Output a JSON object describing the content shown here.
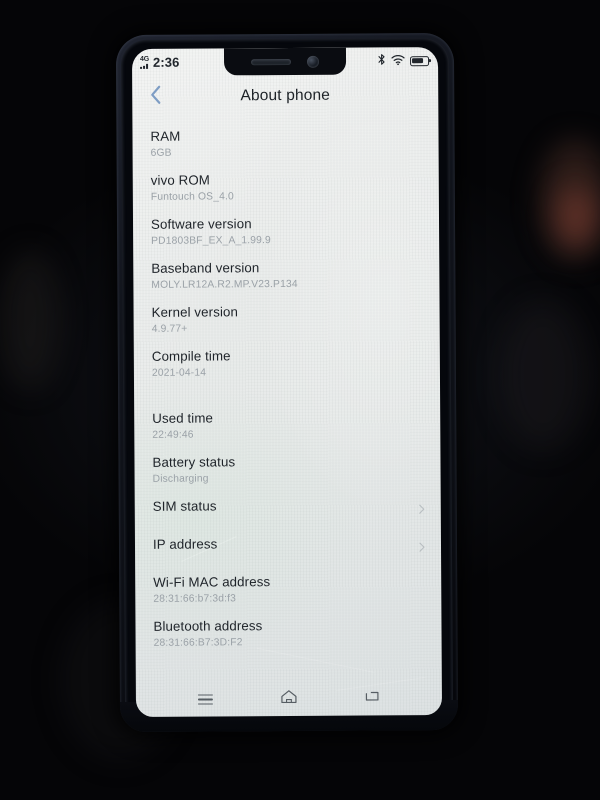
{
  "device": {
    "notch": {
      "earpiece_icon": "earpiece-speaker-icon",
      "camera_icon": "front-camera-icon"
    }
  },
  "status_bar": {
    "network_type": "4G",
    "time": "2:36",
    "bluetooth_icon": "bluetooth-icon",
    "wifi_icon": "wifi-icon",
    "battery_icon": "battery-icon"
  },
  "app_bar": {
    "back_icon": "chevron-left-icon",
    "title": "About phone"
  },
  "list": [
    {
      "label": "RAM",
      "value": "6GB",
      "chevron": false,
      "gap_before": false
    },
    {
      "label": "vivo ROM",
      "value": "Funtouch OS_4.0",
      "chevron": false,
      "gap_before": false
    },
    {
      "label": "Software version",
      "value": "PD1803BF_EX_A_1.99.9",
      "chevron": false,
      "gap_before": false
    },
    {
      "label": "Baseband version",
      "value": "MOLY.LR12A.R2.MP.V23.P134",
      "chevron": false,
      "gap_before": false
    },
    {
      "label": "Kernel version",
      "value": "4.9.77+",
      "chevron": false,
      "gap_before": false
    },
    {
      "label": "Compile time",
      "value": "2021-04-14",
      "chevron": false,
      "gap_before": false
    },
    {
      "label": "Used time",
      "value": "22:49:46",
      "chevron": false,
      "gap_before": true
    },
    {
      "label": "Battery status",
      "value": "Discharging",
      "chevron": false,
      "gap_before": false
    },
    {
      "label": "SIM status",
      "value": "",
      "chevron": true,
      "gap_before": false
    },
    {
      "label": "IP address",
      "value": "",
      "chevron": true,
      "gap_before": false
    },
    {
      "label": "Wi-Fi  MAC  address",
      "value": "28:31:66:b7:3d:f3",
      "chevron": false,
      "gap_before": false
    },
    {
      "label": "Bluetooth address",
      "value": "28:31:66:B7:3D:F2",
      "chevron": false,
      "gap_before": false
    }
  ],
  "nav_bar": {
    "recents_icon": "menu-recents-icon",
    "home_icon": "home-icon",
    "back_icon": "back-square-icon"
  },
  "colors": {
    "label": "#1e2329",
    "value": "#9aa1a7",
    "accent_back": "#7e9dc4",
    "screen_bg": "#eceeed"
  }
}
